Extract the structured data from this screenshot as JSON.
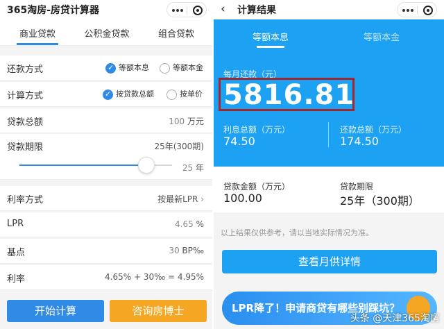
{
  "left": {
    "title": "365淘房-房贷计算器",
    "tabs": [
      "商业贷款",
      "公积金贷款",
      "组合贷款"
    ],
    "repayment": {
      "label": "还款方式",
      "options": [
        "等额本息",
        "等额本金"
      ],
      "selected": 0
    },
    "calc": {
      "label": "计算方式",
      "options": [
        "按贷款总额",
        "按单价"
      ],
      "selected": 0
    },
    "loan_total": {
      "label": "贷款总额",
      "value": "100",
      "unit": "万元"
    },
    "loan_term": {
      "label": "贷款期限",
      "value": "25年(300期)",
      "years": "25",
      "unit": "年",
      "slider_fraction": 0.83
    },
    "rate_mode": {
      "label": "利率方式",
      "value": "按最新LPR",
      "chevron": "›"
    },
    "lpr": {
      "label": "LPR",
      "value": "4.65",
      "unit": "%"
    },
    "bp": {
      "label": "基点",
      "value": "30",
      "unit": "BP‰"
    },
    "rate": {
      "label": "利率",
      "value": "4.65% + 30‰ = 4.95%"
    },
    "buttons": {
      "start": "开始计算",
      "consult": "咨询房博士"
    }
  },
  "right": {
    "title": "计算结果",
    "back": "‹",
    "tabs": [
      "等额本息",
      "等额本金"
    ],
    "monthly_label": "每月还款（元）",
    "monthly_value": "5816.81",
    "interest_label": "利息总额（万元）",
    "interest_value": "74.50",
    "repay_label": "还款总额（万元）",
    "repay_value": "174.50",
    "loan_label": "贷款金额（万元）",
    "loan_value": "100.00",
    "term_label": "贷款期限",
    "term_value": "25年（300期）",
    "note": "以上结果仅供参考，请以当地实际情况为准。",
    "detail_button": "查看月供详情",
    "banner": "LPR降了！申请商贷有哪些别踩坑？",
    "watermark": "头条 @天津365淘房"
  },
  "colors": {
    "accent": "#2f8be6",
    "blue_panel": "#1da1f2",
    "orange": "#f5a623",
    "highlight_box": "#a3262a"
  }
}
